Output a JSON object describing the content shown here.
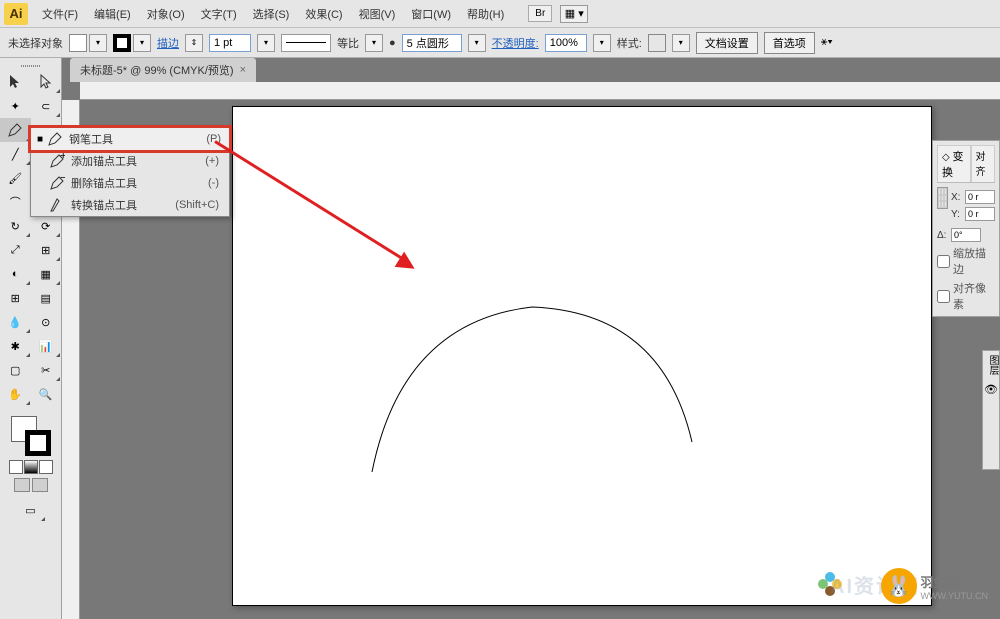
{
  "menubar": {
    "items": [
      "文件(F)",
      "编辑(E)",
      "对象(O)",
      "文字(T)",
      "选择(S)",
      "效果(C)",
      "视图(V)",
      "窗口(W)",
      "帮助(H)"
    ],
    "br_label": "Br"
  },
  "control_bar": {
    "no_selection": "未选择对象",
    "stroke_label": "描边",
    "stroke_weight": "1 pt",
    "scale_label": "等比",
    "profile_label": "5 点圆形",
    "opacity_label": "不透明度:",
    "opacity_value": "100%",
    "style_label": "样式:",
    "doc_setup": "文档设置",
    "preferences": "首选项"
  },
  "tab": {
    "title": "未标题-5* @ 99% (CMYK/预览)",
    "close": "×"
  },
  "flyout": {
    "items": [
      {
        "label": "钢笔工具",
        "shortcut": "(P)"
      },
      {
        "label": "添加锚点工具",
        "shortcut": "(+)"
      },
      {
        "label": "删除锚点工具",
        "shortcut": "(-)"
      },
      {
        "label": "转换锚点工具",
        "shortcut": "(Shift+C)"
      }
    ]
  },
  "transform_panel": {
    "tab1": "变换",
    "tab2": "对齐",
    "x_label": "X:",
    "y_label": "Y:",
    "x_value": "0 r",
    "y_value": "0 r",
    "angle_label": "Δ:",
    "angle_value": "0°",
    "checkbox1": "缩放描边",
    "checkbox2": "对齐像素"
  },
  "layers_panel": {
    "title": "图层"
  },
  "watermark": {
    "text1": "AI资讯网",
    "text2": "羽兔网",
    "url": "WWW.YUTU.CN"
  }
}
